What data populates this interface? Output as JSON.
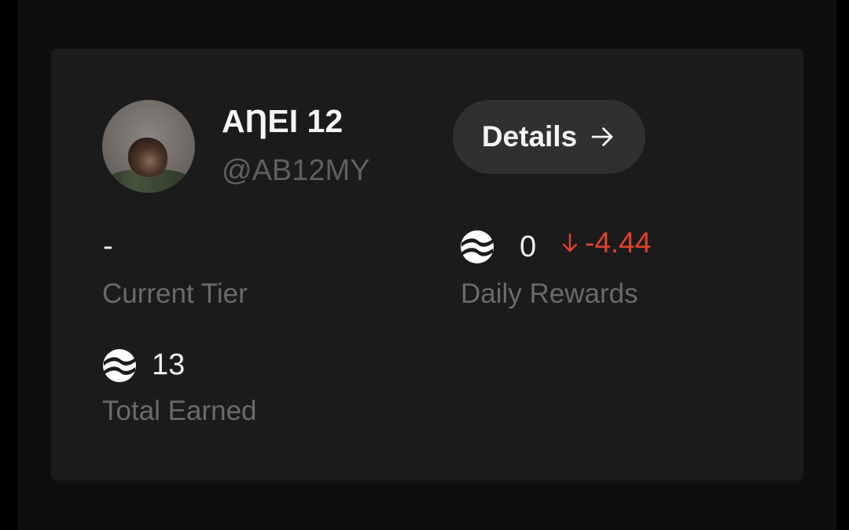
{
  "profile": {
    "display_name": "AȠEI 12",
    "username": "@AB12MY"
  },
  "actions": {
    "details_label": "Details"
  },
  "stats": {
    "current_tier": {
      "value": "-",
      "label": "Current Tier"
    },
    "daily_rewards": {
      "value": "0",
      "change": "-4.44",
      "label": "Daily Rewards"
    },
    "total_earned": {
      "value": "13",
      "label": "Total Earned"
    }
  },
  "icons": {
    "details_arrow": "arrow-right-icon",
    "coin": "coin-icon",
    "change_arrow": "arrow-down-icon"
  },
  "colors": {
    "negative": "#e0412f",
    "card_background": "#1b1b1b",
    "button_background": "#303030"
  }
}
